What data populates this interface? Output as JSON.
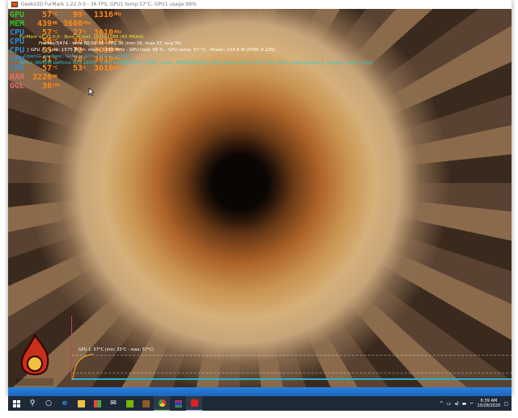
{
  "window": {
    "title": "Geeks3D FurMark 1.22.0.0 - 36 FPS, GPU1 temp:57°C, GPU1 usage:99%"
  },
  "hud": [
    {
      "label": "GPU",
      "color": "#2fbf2f",
      "values": [
        {
          "v": "57",
          "u": "°C"
        },
        {
          "v": "99",
          "u": "%"
        },
        {
          "v": "1316",
          "u": "MHz"
        }
      ]
    },
    {
      "label": "MEM",
      "color": "#2fbf2f",
      "values": [
        {
          "v": "439",
          "u": "MB"
        },
        {
          "v": "3600",
          "u": "MHz"
        }
      ]
    },
    {
      "label": "CPU",
      "color": "#2a8fd8",
      "values": [
        {
          "v": "57",
          "u": "°C"
        },
        {
          "v": "27",
          "u": "%"
        },
        {
          "v": "3010",
          "u": "MHz"
        }
      ]
    },
    {
      "label": "CPU",
      "color": "#2a8fd8",
      "values": [
        {
          "v": "50",
          "u": "°C"
        },
        {
          "v": "36",
          "u": "%"
        },
        {
          "v": "3010",
          "u": "MHz"
        }
      ]
    },
    {
      "label": "CPU",
      "color": "#2a8fd8",
      "values": [
        {
          "v": "55",
          "u": "°C"
        },
        {
          "v": "72",
          "u": "%"
        },
        {
          "v": "3010",
          "u": "MHz"
        }
      ]
    },
    {
      "label": "CPU",
      "color": "#2a8fd8",
      "values": [
        {
          "v": "51",
          "u": "°C"
        },
        {
          "v": "78",
          "u": "%"
        },
        {
          "v": "3010",
          "u": "MHz"
        }
      ]
    },
    {
      "label": "CPU",
      "color": "#2a8fd8",
      "values": [
        {
          "v": "57",
          "u": "°C"
        },
        {
          "v": "53",
          "u": "%"
        },
        {
          "v": "3010",
          "u": "MHz"
        }
      ]
    },
    {
      "label": "RAM",
      "color": "#e07070",
      "values": [
        {
          "v": "3226",
          "u": "MB"
        }
      ]
    },
    {
      "label": "OGL",
      "color": "#e07070",
      "values": [
        {
          "v": "36",
          "u": "FPS"
        }
      ]
    }
  ],
  "info": {
    "line1": "FurMark v1.22.0.0 - Burn-in test, 1920x1080 (4X MSAA)",
    "line2": "Frames:5474 - time:00:02:36 - FPS:36 (min:35, max:37, avg:36)",
    "line3": "[ GPU 2 ] core: 1575 MHz - mem: 1800 MHz - GPU load: 99 % - GPU temp: 57 °C - Power: 153.8 W (PPW: 0.235)",
    "line4": "OpenGL renderer: GeForce GTX 1070/PCIe/SSE2",
    "line5": "GPU 1 (NVIDIA GeForce GTX 1070) - core: 1575MHz/57°C/99%, mem: 3600MHz/50%, GPU power: 101.1% TDP, fan: 50%, limits:[power:1, temp:0, volt:0, OV:0]"
  },
  "graph": {
    "label": "GPU 1: 57°C (min: 33°C - max: 57°C)"
  },
  "logo": {
    "text": "FurMark"
  },
  "taskbar": {
    "items": [
      "start",
      "search",
      "task-view",
      "edge",
      "file-explorer",
      "store",
      "mail",
      "nvidia",
      "app-v",
      "chrome",
      "winrar",
      "furmark"
    ]
  },
  "tray": {
    "time": "6:39 AM",
    "date": "10/28/2020"
  }
}
